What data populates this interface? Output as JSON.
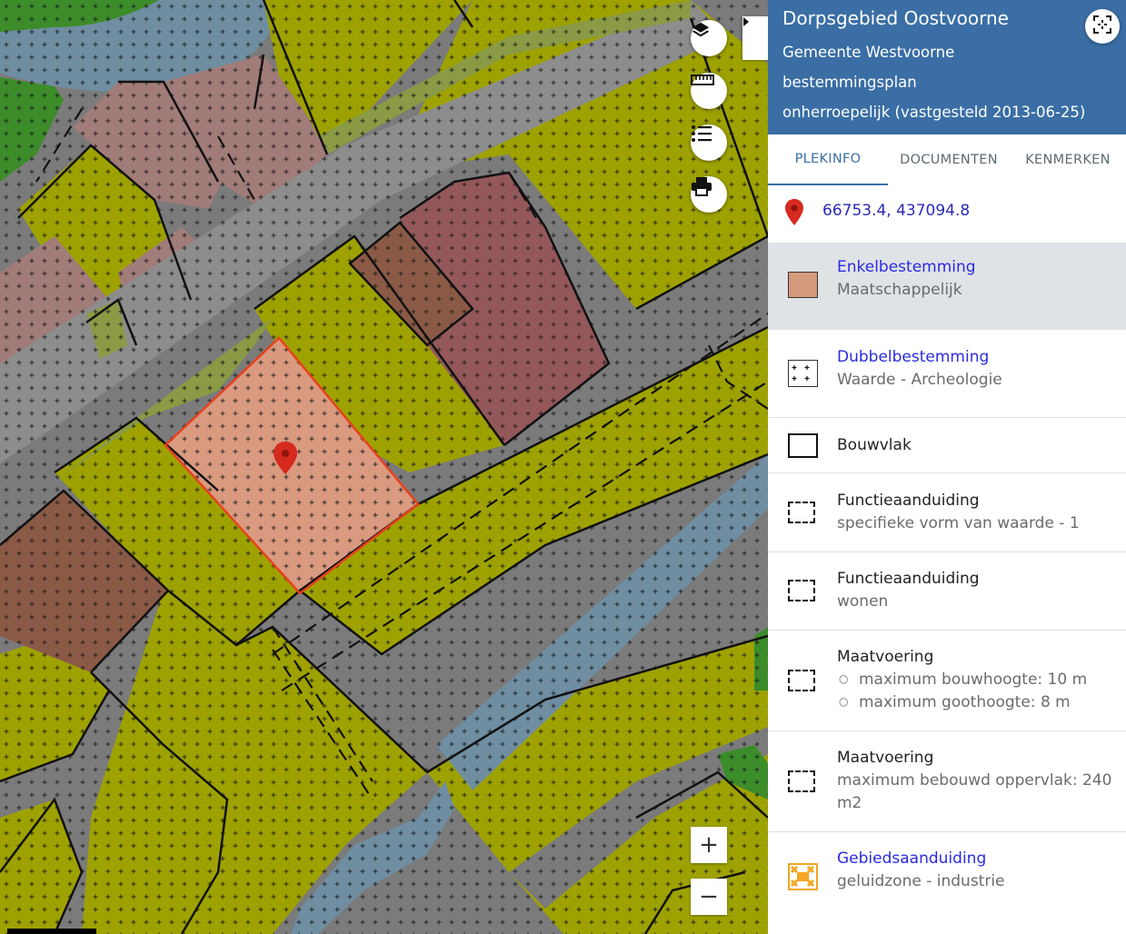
{
  "map": {
    "toggle_icon": "caret-right-icon",
    "buttons": {
      "layers_icon": "layers-icon",
      "measure_icon": "ruler-icon",
      "legend_icon": "list-icon",
      "print_icon": "printer-icon"
    },
    "zoom_in_label": "+",
    "zoom_out_label": "−",
    "marker_icon": "map-pin-icon",
    "colors": {
      "background_grey": "#7b7b7b",
      "green_area": "#9ea200",
      "road_grey": "#8d8d8d",
      "water_blue": "#6f8ea2",
      "pink_area": "#a17c79",
      "brown_area": "#8b5a46",
      "dark_red_area": "#94585a",
      "dark_green_area": "#3c8c2a",
      "olive_strip": "#8a9a45",
      "selected_fill": "#d99a80",
      "selected_stroke": "#e8401e"
    }
  },
  "panel": {
    "title": "Dorpsgebied Oostvoorne",
    "municipality": "Gemeente Westvoorne",
    "plan_type": "bestemmingsplan",
    "status": "onherroepelijk (vastgesteld 2013-06-25)",
    "focus_icon": "focus-target-icon",
    "header_color": "#3a6ea5",
    "tabs": [
      {
        "label": "PLEKINFO",
        "active": true
      },
      {
        "label": "DOCUMENTEN",
        "active": false
      },
      {
        "label": "KENMERKEN",
        "active": false
      }
    ],
    "coordinates": "66753.4, 437094.8",
    "entries": [
      {
        "title": "Enkelbestemming",
        "subtitle": "Maatschappelijk",
        "swatch_color": "#d59a7c"
      },
      {
        "title": "Dubbelbestemming",
        "subtitle": "Waarde - Archeologie"
      },
      {
        "title": "Bouwvlak"
      },
      {
        "title": "Functieaanduiding",
        "subtitle": "specifieke vorm van waarde - 1"
      },
      {
        "title": "Functieaanduiding",
        "subtitle": "wonen"
      },
      {
        "title": "Maatvoering",
        "items": [
          "maximum bouwhoogte: 10 m",
          "maximum goothoogte: 8 m"
        ]
      },
      {
        "title": "Maatvoering",
        "subtitle_line1": "maximum bebouwd oppervlak: 240",
        "subtitle_line2": "m2"
      },
      {
        "title": "Gebiedsaanduiding",
        "subtitle": "geluidzone - industrie",
        "swatch_color": "#f5a623"
      }
    ]
  }
}
